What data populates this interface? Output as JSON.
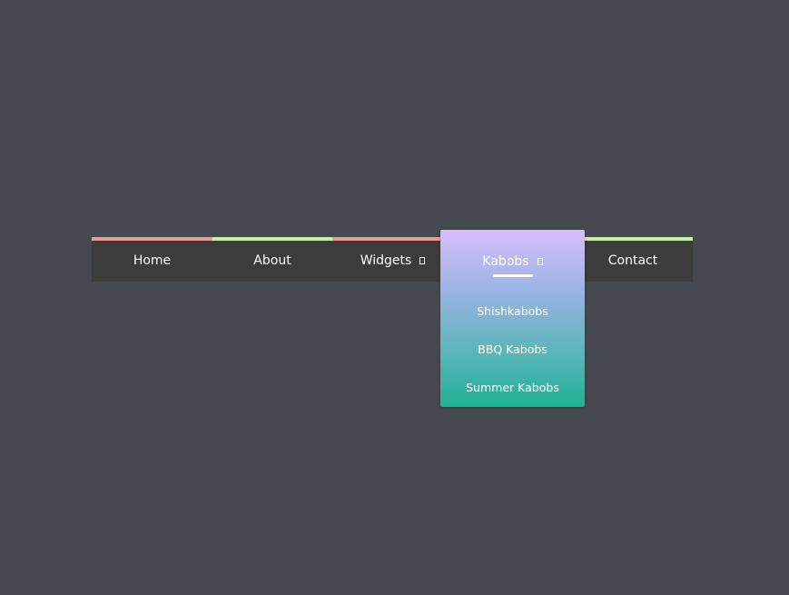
{
  "menu": {
    "items": [
      {
        "label": "Home",
        "bar_color": "#f2998a"
      },
      {
        "label": "About",
        "bar_color": "#c5f2a4"
      },
      {
        "label": "Widgets",
        "bar_color": "#f2998a",
        "has_submenu": true,
        "submenu_icon": "square-icon"
      },
      {
        "label": "Kabobs",
        "bar_color": "#c5f2a4",
        "has_submenu": true,
        "submenu_icon": "square-icon",
        "expanded": true
      },
      {
        "label": "Contact",
        "bar_color": "#c5f2a4"
      }
    ]
  },
  "dropdown": {
    "title": "Kabobs",
    "items": [
      {
        "label": "Shishkabobs"
      },
      {
        "label": "BBQ Kabobs"
      },
      {
        "label": "Summer Kabobs"
      }
    ]
  },
  "colors": {
    "background": "#464a50",
    "nav_background": "#3d3c3c",
    "dropdown_gradient": [
      "#d8bcff",
      "#1fb195"
    ],
    "text": "#ffffff"
  }
}
